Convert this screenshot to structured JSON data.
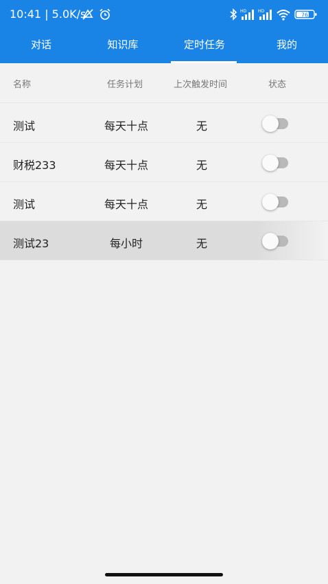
{
  "status_bar": {
    "time_speed": "10:41 | 5.0K/s",
    "battery": "76",
    "hd_label": "HD"
  },
  "tabs": [
    {
      "label": "对话",
      "active": false
    },
    {
      "label": "知识库",
      "active": false
    },
    {
      "label": "定时任务",
      "active": true
    },
    {
      "label": "我的",
      "active": false
    }
  ],
  "table": {
    "headers": {
      "name": "名称",
      "schedule": "任务计划",
      "last_trigger": "上次触发时间",
      "status": "状态"
    },
    "rows": [
      {
        "name": "测试",
        "schedule": "每天十点",
        "last_trigger": "无",
        "enabled": false
      },
      {
        "name": "财税233",
        "schedule": "每天十点",
        "last_trigger": "无",
        "enabled": false
      },
      {
        "name": "测试",
        "schedule": "每天十点",
        "last_trigger": "无",
        "enabled": false
      },
      {
        "name": "测试23",
        "schedule": "每小时",
        "last_trigger": "无",
        "enabled": false
      }
    ]
  },
  "colors": {
    "primary": "#1a84e6",
    "background": "#f2f2f2",
    "toggle_off_track": "#b9b9b9"
  }
}
